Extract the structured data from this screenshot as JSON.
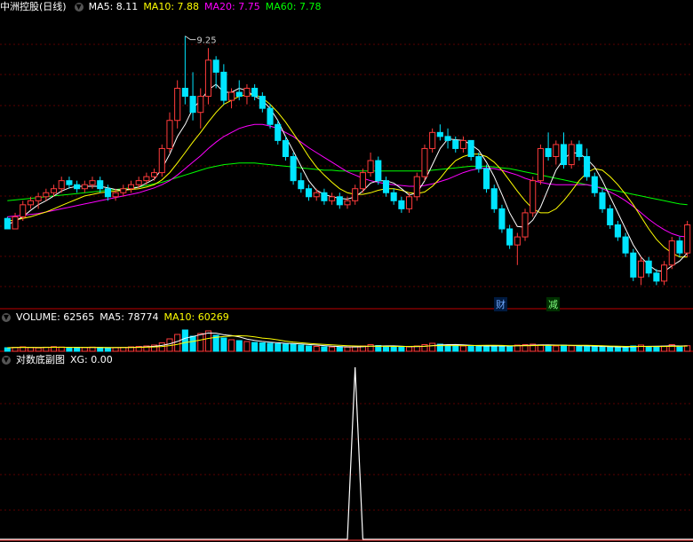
{
  "header": {
    "stock_name": "中洲控股(日线)",
    "ma_labels": [
      {
        "text": "MA5: 8.11",
        "color": "#ffffff"
      },
      {
        "text": "MA10: 7.88",
        "color": "#ffff00"
      },
      {
        "text": "MA20: 7.75",
        "color": "#ff00ff"
      },
      {
        "text": "MA60: 7.78",
        "color": "#00ff00"
      }
    ]
  },
  "volume_header": {
    "labels": [
      {
        "text": "VOLUME: 62565",
        "color": "#ffffff"
      },
      {
        "text": "MA5: 78774",
        "color": "#ffffff"
      },
      {
        "text": "MA10: 60269",
        "color": "#ffff00"
      }
    ]
  },
  "indicator_header": {
    "name": "对数底副图",
    "xg": "XG: 0.00"
  },
  "markers": [
    {
      "text": "财",
      "color": "#6fa8ff",
      "bg": "#001a40"
    },
    {
      "text": "减",
      "color": "#7fff7f",
      "bg": "#003000"
    }
  ],
  "colors": {
    "up": "#ff3b3b",
    "down": "#00e5ff",
    "ma5": "#ffffff",
    "ma10": "#ffff00",
    "ma20": "#ff00ff",
    "ma60": "#00ff00",
    "grid": "#5a0000",
    "separator": "#c00000"
  },
  "chart_data": [
    {
      "type": "candlestick",
      "title": "中洲控股(日线)",
      "annotations": [
        {
          "text": "9.25"
        }
      ],
      "ylim": [
        6.0,
        9.5
      ],
      "candles": [
        [
          6.98,
          7.0,
          6.85,
          6.85
        ],
        [
          6.85,
          7.05,
          6.85,
          7.0
        ],
        [
          7.0,
          7.2,
          6.95,
          7.15
        ],
        [
          7.15,
          7.25,
          7.1,
          7.2
        ],
        [
          7.2,
          7.3,
          7.1,
          7.25
        ],
        [
          7.25,
          7.35,
          7.2,
          7.3
        ],
        [
          7.3,
          7.4,
          7.25,
          7.35
        ],
        [
          7.35,
          7.5,
          7.3,
          7.45
        ],
        [
          7.45,
          7.5,
          7.35,
          7.4
        ],
        [
          7.4,
          7.45,
          7.3,
          7.35
        ],
        [
          7.35,
          7.45,
          7.3,
          7.4
        ],
        [
          7.4,
          7.5,
          7.35,
          7.45
        ],
        [
          7.45,
          7.5,
          7.3,
          7.35
        ],
        [
          7.35,
          7.4,
          7.2,
          7.25
        ],
        [
          7.25,
          7.35,
          7.2,
          7.3
        ],
        [
          7.3,
          7.4,
          7.25,
          7.35
        ],
        [
          7.35,
          7.45,
          7.3,
          7.4
        ],
        [
          7.4,
          7.5,
          7.35,
          7.45
        ],
        [
          7.45,
          7.55,
          7.4,
          7.5
        ],
        [
          7.5,
          7.6,
          7.45,
          7.55
        ],
        [
          7.55,
          7.9,
          7.5,
          7.85
        ],
        [
          7.85,
          8.3,
          7.8,
          8.2
        ],
        [
          8.2,
          8.7,
          8.1,
          8.6
        ],
        [
          8.6,
          9.25,
          8.4,
          8.5
        ],
        [
          8.5,
          8.8,
          8.2,
          8.3
        ],
        [
          8.3,
          8.6,
          8.1,
          8.5
        ],
        [
          8.5,
          9.1,
          8.4,
          8.95
        ],
        [
          8.95,
          9.0,
          8.6,
          8.8
        ],
        [
          8.8,
          8.9,
          8.4,
          8.45
        ],
        [
          8.45,
          8.6,
          8.35,
          8.55
        ],
        [
          8.55,
          8.7,
          8.45,
          8.5
        ],
        [
          8.5,
          8.65,
          8.4,
          8.6
        ],
        [
          8.6,
          8.65,
          8.45,
          8.5
        ],
        [
          8.5,
          8.55,
          8.3,
          8.35
        ],
        [
          8.35,
          8.4,
          8.1,
          8.15
        ],
        [
          8.15,
          8.2,
          7.9,
          7.95
        ],
        [
          7.95,
          8.0,
          7.7,
          7.75
        ],
        [
          7.75,
          7.8,
          7.4,
          7.45
        ],
        [
          7.45,
          7.55,
          7.3,
          7.35
        ],
        [
          7.35,
          7.4,
          7.2,
          7.25
        ],
        [
          7.25,
          7.35,
          7.2,
          7.3
        ],
        [
          7.3,
          7.35,
          7.15,
          7.2
        ],
        [
          7.2,
          7.3,
          7.15,
          7.25
        ],
        [
          7.25,
          7.3,
          7.1,
          7.15
        ],
        [
          7.15,
          7.25,
          7.1,
          7.2
        ],
        [
          7.2,
          7.4,
          7.15,
          7.35
        ],
        [
          7.35,
          7.6,
          7.3,
          7.55
        ],
        [
          7.55,
          7.8,
          7.5,
          7.7
        ],
        [
          7.7,
          7.75,
          7.4,
          7.45
        ],
        [
          7.45,
          7.5,
          7.25,
          7.3
        ],
        [
          7.3,
          7.35,
          7.15,
          7.2
        ],
        [
          7.2,
          7.25,
          7.05,
          7.1
        ],
        [
          7.1,
          7.3,
          7.05,
          7.25
        ],
        [
          7.25,
          7.55,
          7.2,
          7.5
        ],
        [
          7.5,
          7.9,
          7.45,
          7.85
        ],
        [
          7.85,
          8.1,
          7.8,
          8.05
        ],
        [
          8.05,
          8.15,
          7.95,
          8.0
        ],
        [
          8.0,
          8.1,
          7.85,
          7.95
        ],
        [
          7.95,
          8.0,
          7.8,
          7.85
        ],
        [
          7.85,
          8.0,
          7.8,
          7.95
        ],
        [
          7.95,
          7.95,
          7.7,
          7.75
        ],
        [
          7.75,
          7.8,
          7.55,
          7.6
        ],
        [
          7.6,
          7.65,
          7.3,
          7.35
        ],
        [
          7.35,
          7.4,
          7.05,
          7.1
        ],
        [
          7.1,
          7.15,
          6.8,
          6.85
        ],
        [
          6.85,
          6.9,
          6.6,
          6.65
        ],
        [
          6.65,
          6.8,
          6.4,
          6.75
        ],
        [
          6.75,
          7.1,
          6.7,
          7.05
        ],
        [
          7.05,
          7.5,
          7.0,
          7.45
        ],
        [
          7.45,
          7.9,
          7.4,
          7.85
        ],
        [
          7.85,
          8.05,
          7.7,
          7.75
        ],
        [
          7.75,
          7.95,
          7.65,
          7.9
        ],
        [
          7.9,
          8.05,
          7.6,
          7.65
        ],
        [
          7.65,
          7.95,
          7.6,
          7.9
        ],
        [
          7.9,
          7.95,
          7.7,
          7.75
        ],
        [
          7.75,
          7.85,
          7.45,
          7.5
        ],
        [
          7.5,
          7.55,
          7.25,
          7.3
        ],
        [
          7.3,
          7.35,
          7.05,
          7.1
        ],
        [
          7.1,
          7.15,
          6.85,
          6.9
        ],
        [
          6.9,
          6.95,
          6.7,
          6.75
        ],
        [
          6.75,
          6.8,
          6.5,
          6.55
        ],
        [
          6.55,
          6.6,
          6.2,
          6.25
        ],
        [
          6.25,
          6.5,
          6.15,
          6.45
        ],
        [
          6.45,
          6.5,
          6.25,
          6.3
        ],
        [
          6.3,
          6.35,
          6.15,
          6.2
        ],
        [
          6.2,
          6.45,
          6.15,
          6.4
        ],
        [
          6.4,
          6.75,
          6.35,
          6.7
        ],
        [
          6.7,
          6.75,
          6.5,
          6.55
        ],
        [
          6.55,
          6.95,
          6.5,
          6.9
        ]
      ],
      "ma5": [
        6.9,
        6.95,
        7.0,
        7.08,
        7.15,
        7.2,
        7.26,
        7.32,
        7.36,
        7.38,
        7.38,
        7.38,
        7.38,
        7.36,
        7.34,
        7.33,
        7.35,
        7.37,
        7.42,
        7.47,
        7.6,
        7.78,
        8.0,
        8.15,
        8.35,
        8.45,
        8.58,
        8.65,
        8.55,
        8.55,
        8.6,
        8.57,
        8.5,
        8.45,
        8.35,
        8.2,
        8.0,
        7.82,
        7.63,
        7.45,
        7.33,
        7.28,
        7.25,
        7.23,
        7.22,
        7.25,
        7.32,
        7.42,
        7.45,
        7.45,
        7.42,
        7.35,
        7.27,
        7.3,
        7.45,
        7.65,
        7.85,
        7.97,
        7.96,
        7.95,
        7.9,
        7.83,
        7.68,
        7.5,
        7.28,
        7.05,
        6.88,
        6.87,
        6.96,
        7.12,
        7.35,
        7.58,
        7.72,
        7.8,
        7.79,
        7.72,
        7.62,
        7.45,
        7.25,
        7.05,
        6.85,
        6.65,
        6.5,
        6.4,
        6.33,
        6.32,
        6.39,
        6.45,
        6.55
      ],
      "ma10": [
        6.95,
        6.96,
        6.98,
        7.0,
        7.03,
        7.06,
        7.1,
        7.14,
        7.18,
        7.22,
        7.26,
        7.28,
        7.3,
        7.31,
        7.32,
        7.33,
        7.34,
        7.35,
        7.37,
        7.4,
        7.46,
        7.55,
        7.67,
        7.8,
        7.93,
        8.05,
        8.18,
        8.3,
        8.4,
        8.45,
        8.5,
        8.52,
        8.52,
        8.48,
        8.4,
        8.3,
        8.18,
        8.04,
        7.9,
        7.75,
        7.62,
        7.52,
        7.43,
        7.35,
        7.3,
        7.28,
        7.28,
        7.3,
        7.33,
        7.35,
        7.35,
        7.33,
        7.3,
        7.29,
        7.31,
        7.38,
        7.48,
        7.6,
        7.7,
        7.75,
        7.78,
        7.78,
        7.75,
        7.68,
        7.58,
        7.45,
        7.32,
        7.2,
        7.1,
        7.05,
        7.05,
        7.1,
        7.2,
        7.32,
        7.45,
        7.55,
        7.6,
        7.58,
        7.5,
        7.4,
        7.28,
        7.15,
        7.0,
        6.85,
        6.72,
        6.62,
        6.55,
        6.5,
        6.5
      ],
      "ma20": [
        7.0,
        7.01,
        7.02,
        7.03,
        7.04,
        7.06,
        7.08,
        7.1,
        7.12,
        7.14,
        7.16,
        7.18,
        7.2,
        7.22,
        7.24,
        7.26,
        7.28,
        7.3,
        7.33,
        7.36,
        7.4,
        7.45,
        7.52,
        7.6,
        7.68,
        7.76,
        7.85,
        7.93,
        8.0,
        8.05,
        8.1,
        8.13,
        8.15,
        8.15,
        8.13,
        8.1,
        8.05,
        8.0,
        7.93,
        7.86,
        7.8,
        7.74,
        7.68,
        7.62,
        7.56,
        7.52,
        7.48,
        7.45,
        7.43,
        7.41,
        7.4,
        7.39,
        7.38,
        7.38,
        7.39,
        7.41,
        7.44,
        7.47,
        7.51,
        7.55,
        7.58,
        7.6,
        7.61,
        7.6,
        7.58,
        7.55,
        7.52,
        7.48,
        7.45,
        7.43,
        7.41,
        7.4,
        7.4,
        7.4,
        7.4,
        7.4,
        7.38,
        7.35,
        7.31,
        7.26,
        7.2,
        7.13,
        7.05,
        6.97,
        6.9,
        6.84,
        6.79,
        6.76,
        6.75
      ],
      "ma60": [
        7.2,
        7.21,
        7.22,
        7.23,
        7.24,
        7.25,
        7.26,
        7.27,
        7.28,
        7.29,
        7.3,
        7.31,
        7.32,
        7.33,
        7.34,
        7.35,
        7.36,
        7.37,
        7.39,
        7.41,
        7.43,
        7.46,
        7.49,
        7.52,
        7.55,
        7.58,
        7.61,
        7.63,
        7.65,
        7.66,
        7.67,
        7.67,
        7.67,
        7.66,
        7.65,
        7.64,
        7.63,
        7.62,
        7.61,
        7.6,
        7.59,
        7.58,
        7.58,
        7.57,
        7.57,
        7.57,
        7.57,
        7.57,
        7.57,
        7.57,
        7.57,
        7.57,
        7.57,
        7.57,
        7.57,
        7.58,
        7.59,
        7.6,
        7.61,
        7.62,
        7.63,
        7.63,
        7.63,
        7.62,
        7.61,
        7.6,
        7.58,
        7.56,
        7.54,
        7.52,
        7.5,
        7.48,
        7.46,
        7.44,
        7.42,
        7.4,
        7.38,
        7.36,
        7.34,
        7.32,
        7.3,
        7.28,
        7.26,
        7.24,
        7.22,
        7.2,
        7.18,
        7.16,
        7.15
      ]
    },
    {
      "type": "bar",
      "title": "VOLUME",
      "ylim": [
        0,
        300000
      ],
      "values": [
        40000,
        45000,
        50000,
        42000,
        38000,
        46000,
        52000,
        48000,
        40000,
        36000,
        42000,
        47000,
        44000,
        38000,
        41000,
        45000,
        50000,
        55000,
        60000,
        70000,
        95000,
        140000,
        190000,
        240000,
        170000,
        200000,
        230000,
        180000,
        150000,
        130000,
        120000,
        110000,
        100000,
        95000,
        90000,
        85000,
        80000,
        85000,
        70000,
        60000,
        55000,
        50000,
        48000,
        52000,
        47000,
        50000,
        60000,
        75000,
        65000,
        55000,
        48000,
        46000,
        50000,
        60000,
        75000,
        90000,
        80000,
        70000,
        65000,
        60000,
        58000,
        55000,
        60000,
        65000,
        62000,
        58000,
        70000,
        75000,
        80000,
        72000,
        65000,
        60000,
        70000,
        62000,
        58000,
        55000,
        52000,
        50000,
        48000,
        46000,
        50000,
        60000,
        70000,
        55000,
        50000,
        58000,
        75000,
        60000,
        62565
      ]
    },
    {
      "type": "line",
      "title": "对数底副图",
      "ylim": [
        0,
        1
      ],
      "spike_index": 45,
      "values_note_free": true,
      "values": [
        0,
        0,
        0,
        0,
        0,
        0,
        0,
        0,
        0,
        0,
        0,
        0,
        0,
        0,
        0,
        0,
        0,
        0,
        0,
        0,
        0,
        0,
        0,
        0,
        0,
        0,
        0,
        0,
        0,
        0,
        0,
        0,
        0,
        0,
        0,
        0,
        0,
        0,
        0,
        0,
        0,
        0,
        0,
        0,
        0,
        1,
        0,
        0,
        0,
        0,
        0,
        0,
        0,
        0,
        0,
        0,
        0,
        0,
        0,
        0,
        0,
        0,
        0,
        0,
        0,
        0,
        0,
        0,
        0,
        0,
        0,
        0,
        0,
        0,
        0,
        0,
        0,
        0,
        0,
        0,
        0,
        0,
        0,
        0,
        0,
        0,
        0,
        0,
        0
      ]
    }
  ]
}
